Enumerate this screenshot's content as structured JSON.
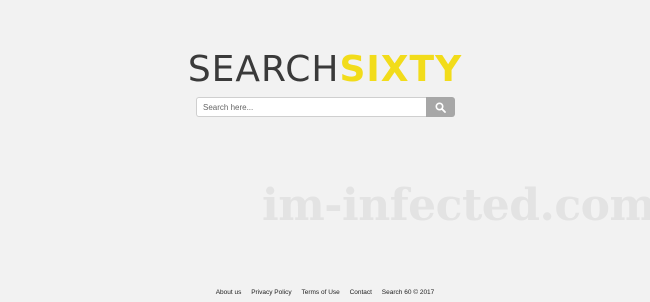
{
  "logo": {
    "part1": "SEARCH",
    "part2": "SIXTY",
    "part1_color": "#3a3a3a",
    "part2_color": "#f2dc1a"
  },
  "search": {
    "placeholder": "Search here...",
    "value": "",
    "button_icon": "search-icon",
    "button_color": "#a7a7a7"
  },
  "watermark": {
    "text": "im-infected.com"
  },
  "footer": {
    "links": [
      "About us",
      "Privacy Policy",
      "Terms of Use",
      "Contact"
    ],
    "copyright": "Search 60 © 2017"
  },
  "colors": {
    "background": "#f2f2f2"
  }
}
